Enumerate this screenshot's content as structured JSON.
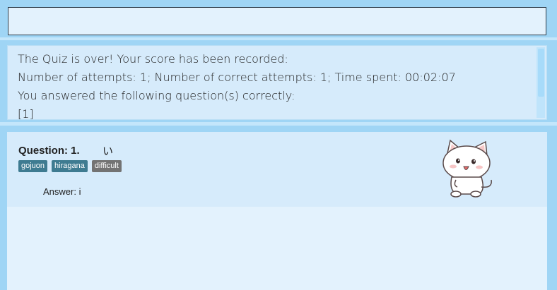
{
  "command_box": {
    "value": ""
  },
  "result": {
    "lines": [
      "The Quiz is over! Your score has been recorded:",
      "Number of attempts: 1; Number of correct attempts: 1; Time spent: 00:02:07",
      "You answered the following question(s) correctly:",
      "[1]"
    ]
  },
  "question": {
    "title": "Question: 1.",
    "kana": "い",
    "tags": [
      {
        "label": "gojuon",
        "color": "#3e7b91"
      },
      {
        "label": "hiragana",
        "color": "#3e7b91"
      },
      {
        "label": "difficult",
        "color": "#737373"
      }
    ],
    "answer": "Answer: i"
  },
  "colors": {
    "background": "#9fd5f5",
    "panel": "#d6ebfb",
    "panel_light": "#e3f2fd"
  },
  "icons": {
    "mascot": "cat-mascot-icon"
  }
}
